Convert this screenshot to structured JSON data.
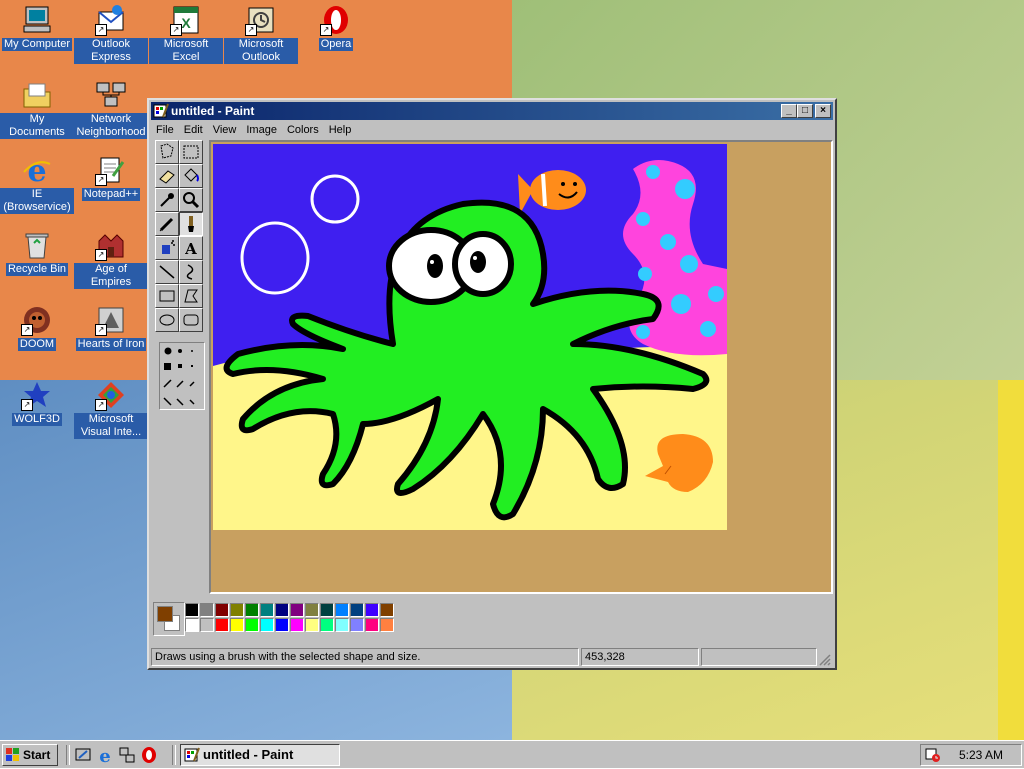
{
  "desktop": {
    "icons": [
      {
        "label": "My Computer",
        "icon": "my-computer-icon"
      },
      {
        "label": "Outlook Express",
        "icon": "outlook-express-icon"
      },
      {
        "label": "Microsoft Excel",
        "icon": "excel-icon"
      },
      {
        "label": "Microsoft Outlook",
        "icon": "outlook-icon"
      },
      {
        "label": "Opera",
        "icon": "opera-icon"
      },
      {
        "label": "My Documents",
        "icon": "my-documents-icon"
      },
      {
        "label": "Network Neighborhood",
        "icon": "network-icon"
      },
      {
        "label": "IE (Browservice)",
        "icon": "internet-explorer-icon"
      },
      {
        "label": "Notepad++",
        "icon": "notepad-icon"
      },
      {
        "label": "Recycle Bin",
        "icon": "recycle-bin-icon"
      },
      {
        "label": "Age of Empires",
        "icon": "age-of-empires-icon"
      },
      {
        "label": "DOOM",
        "icon": "doom-icon"
      },
      {
        "label": "Hearts of Iron",
        "icon": "hearts-of-iron-icon"
      },
      {
        "label": "WOLF3D",
        "icon": "wolf3d-icon"
      },
      {
        "label": "Microsoft Visual Inte...",
        "icon": "visual-interdev-icon"
      }
    ]
  },
  "window": {
    "title": "untitled - Paint",
    "minimize": "_",
    "maximize": "□",
    "close": "×"
  },
  "menu": {
    "file": "File",
    "edit": "Edit",
    "view": "View",
    "image": "Image",
    "colors": "Colors",
    "help": "Help"
  },
  "tools": [
    "free-select",
    "select",
    "eraser",
    "fill",
    "pick-color",
    "magnifier",
    "pencil",
    "brush",
    "airbrush",
    "text",
    "line",
    "curve",
    "rectangle",
    "polygon",
    "ellipse",
    "rounded-rectangle"
  ],
  "selected_tool": "brush",
  "colors": {
    "foreground": "#7f3f00",
    "background": "#ffffff",
    "palette_top": [
      "#000000",
      "#808080",
      "#800000",
      "#808000",
      "#008000",
      "#008080",
      "#000080",
      "#800080",
      "#808040",
      "#004040",
      "#0080ff",
      "#004080",
      "#4000ff",
      "#804000"
    ],
    "palette_bottom": [
      "#ffffff",
      "#c0c0c0",
      "#ff0000",
      "#ffff00",
      "#00ff00",
      "#00ffff",
      "#0000ff",
      "#ff00ff",
      "#ffff80",
      "#00ff80",
      "#80ffff",
      "#8080ff",
      "#ff0080",
      "#ff8040"
    ],
    "canvas_sea": "#3f1ff0",
    "canvas_sand": "#fff68a",
    "canvas_octopus": "#22ee22",
    "canvas_coral": "#ff44dd",
    "canvas_coral_spots": "#33ccff",
    "canvas_fish": "#ff8c1a",
    "workspace": "#c8a060"
  },
  "status": {
    "hint": "Draws using a brush with the selected shape and size.",
    "coords": "453,328",
    "size": ""
  },
  "taskbar": {
    "start": "Start",
    "task_label": "untitled - Paint",
    "time": "5:23 AM"
  }
}
